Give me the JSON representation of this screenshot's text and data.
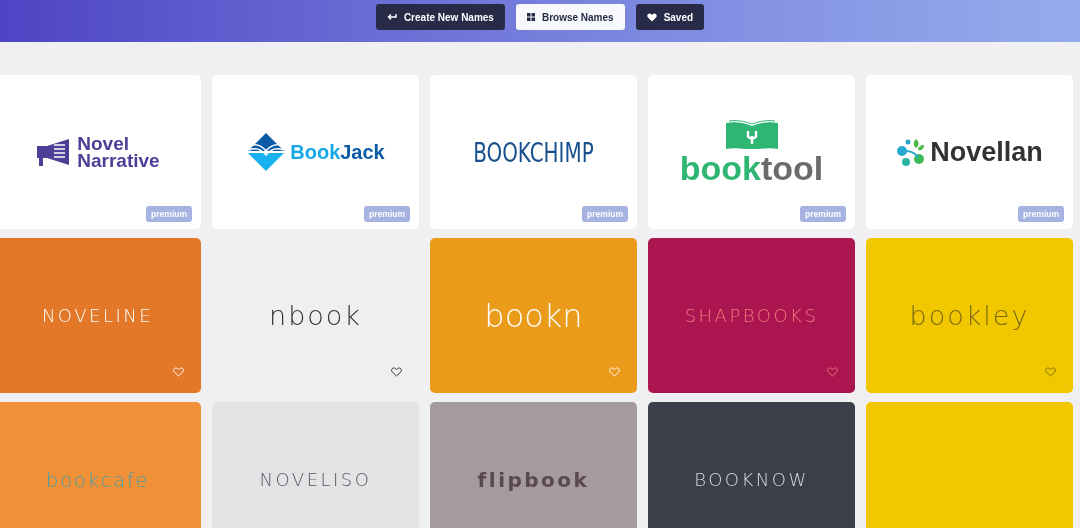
{
  "nav": [
    {
      "label": "Create New Names",
      "selected": false
    },
    {
      "label": "Browse Names",
      "selected": true
    },
    {
      "label": "Saved",
      "selected": false
    }
  ],
  "premium_cards": [
    {
      "parts": [
        "Novel",
        "Narrative"
      ],
      "badge": "premium"
    },
    {
      "parts": [
        "Book",
        "Jack"
      ],
      "badge": "premium"
    },
    {
      "parts": [
        "BOOKCHIMP"
      ],
      "badge": "premium"
    },
    {
      "parts": [
        "book",
        "tool"
      ],
      "badge": "premium"
    },
    {
      "parts": [
        "Novellan"
      ],
      "badge": "premium"
    }
  ],
  "name_cards": [
    {
      "kind": "name",
      "name": "NOVELINE",
      "saved": false
    },
    {
      "kind": "name",
      "name": "nbook",
      "saved": false
    },
    {
      "kind": "name",
      "name": "bookn",
      "saved": false
    },
    {
      "kind": "name",
      "name": "SHAPBOOKS",
      "saved": false
    },
    {
      "kind": "name",
      "name": "bookley",
      "saved": false
    },
    {
      "kind": "name",
      "name": "bookcafe"
    },
    {
      "kind": "name",
      "name": "NOVELISO"
    },
    {
      "kind": "name",
      "name": "flipbook"
    },
    {
      "kind": "name",
      "name": "BOOKNOW"
    },
    {
      "kind": "blank"
    }
  ]
}
